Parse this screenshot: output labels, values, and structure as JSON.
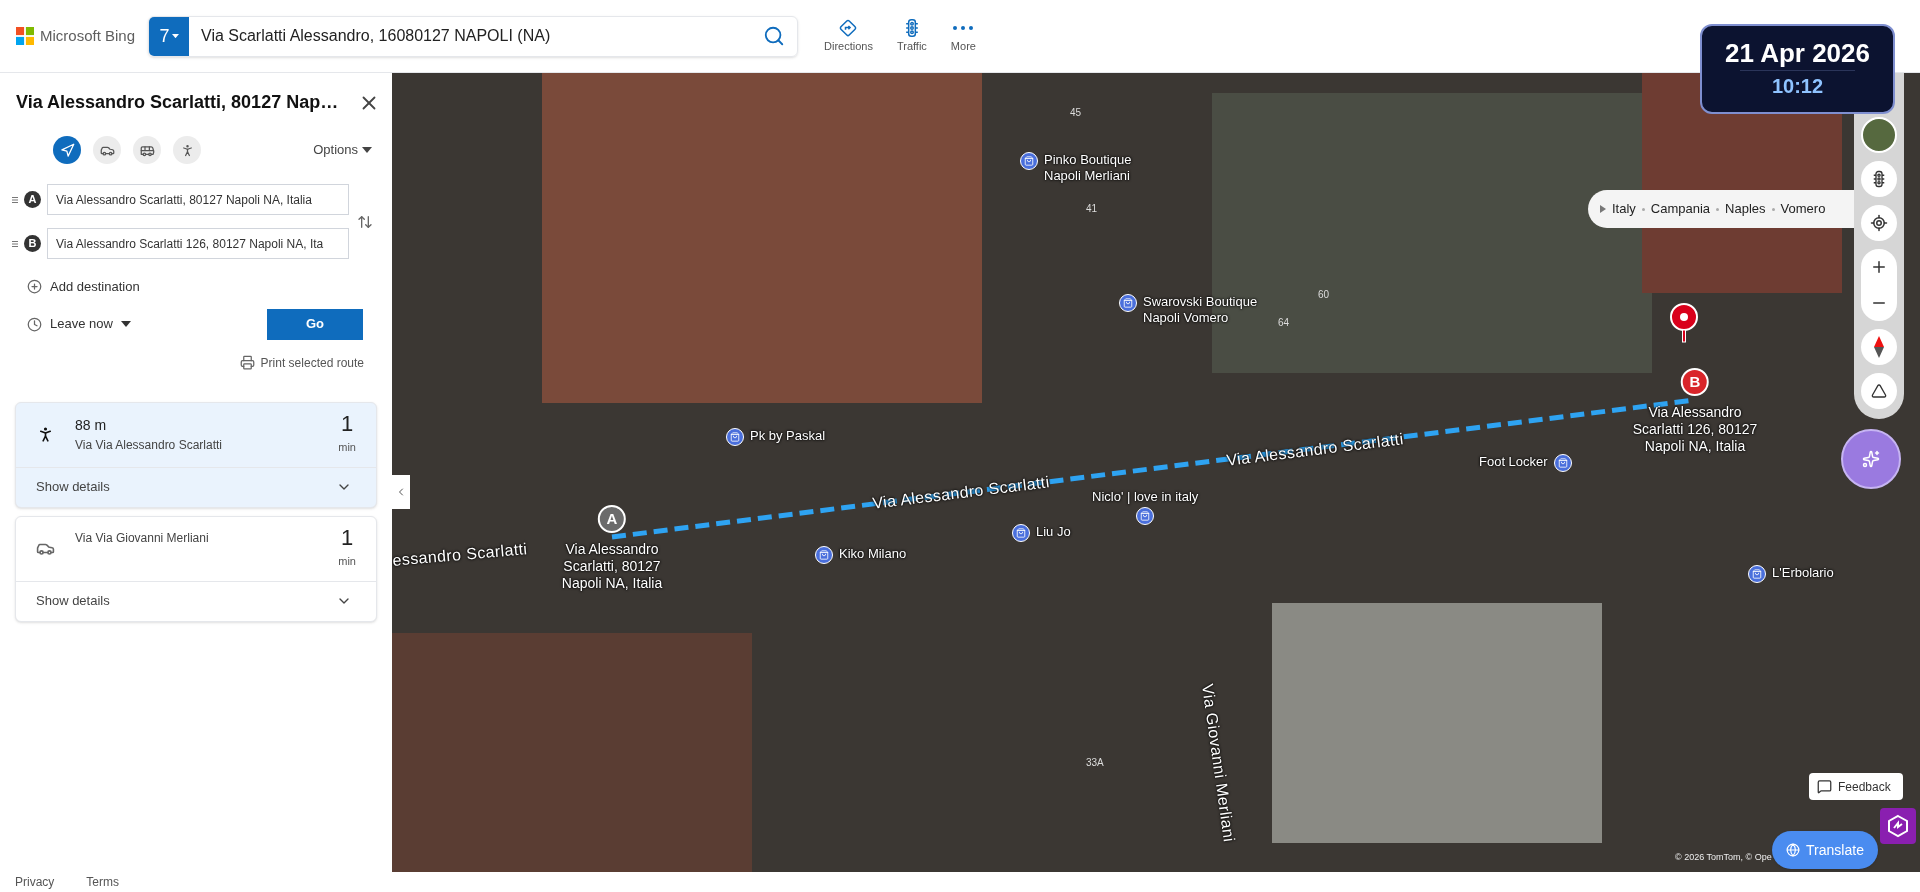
{
  "header": {
    "logo": "Microsoft Bing",
    "search": {
      "badge": "7",
      "value": "Via Scarlatti Alessandro, 16080127 NAPOLI (NA)"
    },
    "nav": [
      {
        "kind": "directions",
        "label": "Directions"
      },
      {
        "kind": "traffic",
        "label": "Traffic"
      },
      {
        "kind": "more",
        "label": "More"
      }
    ]
  },
  "clock": {
    "date": "21 Apr 2026",
    "time": "10:12"
  },
  "sidebar": {
    "title": "Via Alessandro Scarlatti, 80127 Nap…",
    "modes": [
      {
        "kind": "auto",
        "selected": true
      },
      {
        "kind": "drive",
        "selected": false
      },
      {
        "kind": "transit",
        "selected": false
      },
      {
        "kind": "walk",
        "selected": false
      }
    ],
    "options": "Options",
    "waypoints": [
      {
        "marker": "A",
        "value": "Via Alessandro Scarlatti, 80127 Napoli NA, Italia"
      },
      {
        "marker": "B",
        "value": "Via Alessandro Scarlatti 126, 80127 Napoli NA, Ita"
      }
    ],
    "add_destination": "Add destination",
    "leave": "Leave now",
    "go": "Go",
    "print": "Print selected route",
    "routes": [
      {
        "kind": "walk",
        "distance": "88 m",
        "via": "Via Via Alessandro Scarlatti",
        "duration": "1",
        "unit": "min",
        "details": "Show details",
        "selected": true
      },
      {
        "kind": "drive",
        "via": "Via Via Giovanni Merliani",
        "duration": "1",
        "unit": "min",
        "details": "Show details",
        "selected": false
      }
    ]
  },
  "map": {
    "breadcrumb": [
      "Italy",
      "Campania",
      "Naples",
      "Vomero"
    ],
    "streets": [
      "Via Alessandro Scarlatti",
      "Via Alessandro Scarlatti",
      "essandro Scarlatti",
      "Via Giovanni Merliani"
    ],
    "house_numbers": [
      "45",
      "41",
      "60",
      "64",
      "33A"
    ],
    "pois": [
      {
        "name": "Pinko Boutique\nNapoli Merliani"
      },
      {
        "name": "Swarovski Boutique\nNapoli Vomero"
      },
      {
        "name": "Pk by Paskal"
      },
      {
        "name": "Kiko Milano"
      },
      {
        "name": "Liu Jo"
      },
      {
        "name": "Foot Locker"
      },
      {
        "name": "L'Erbolario"
      },
      {
        "name": "Niclo' | love in italy"
      }
    ],
    "start": {
      "marker": "A",
      "label": "Via Alessandro\nScarlatti, 80127\nNapoli NA, Italia"
    },
    "end": {
      "marker": "B",
      "label": "Via Alessandro\nScarlatti 126, 80127\nNapoli NA, Italia"
    },
    "attribution": "© 2026 TomTom,  © Ope",
    "feedback": "Feedback",
    "translate": "Translate"
  },
  "footer": [
    "Privacy",
    "Terms"
  ]
}
